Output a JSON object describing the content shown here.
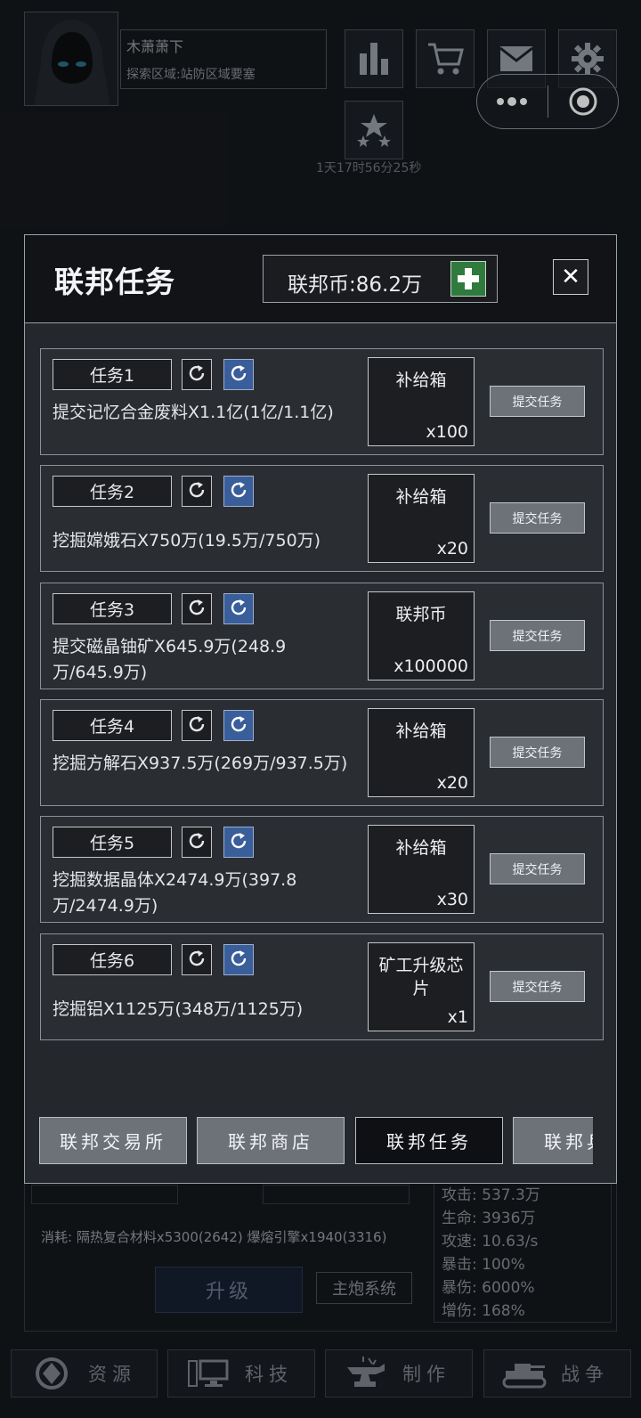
{
  "player": {
    "name": "木萧萧下",
    "region": "探索区域:站防区域要塞",
    "timer": "1天17时56分25秒"
  },
  "top_buttons": [
    "stats-icon",
    "cart-icon",
    "mail-icon",
    "gear-icon",
    "star-icon"
  ],
  "modal": {
    "title": "联邦任务",
    "coin_label": "联邦币:86.2万",
    "close_label": "✕",
    "submit_label": "提交任务",
    "tasks": [
      {
        "name": "任务1",
        "desc": "提交记忆合金废料X1.1亿(1亿/1.1亿)",
        "reward": "补给箱",
        "qty": "x100"
      },
      {
        "name": "任务2",
        "desc": "挖掘嫦娥石X750万(19.5万/750万)",
        "reward": "补给箱",
        "qty": "x20"
      },
      {
        "name": "任务3",
        "desc": "提交磁晶铀矿X645.9万(248.9万/645.9万)",
        "reward": "联邦币",
        "qty": "x100000"
      },
      {
        "name": "任务4",
        "desc": "挖掘方解石X937.5万(269万/937.5万)",
        "reward": "补给箱",
        "qty": "x20"
      },
      {
        "name": "任务5",
        "desc": "挖掘数据晶体X2474.9万(397.8万/2474.9万)",
        "reward": "补给箱",
        "qty": "x30"
      },
      {
        "name": "任务6",
        "desc": "挖掘铝X1125万(348万/1125万)",
        "reward": "矿工升级芯片",
        "qty": "x1"
      }
    ],
    "tabs": [
      {
        "label": "联邦交易所",
        "active": false
      },
      {
        "label": "联邦商店",
        "active": false
      },
      {
        "label": "联邦任务",
        "active": true
      },
      {
        "label": "联邦兵",
        "active": false
      }
    ]
  },
  "background": {
    "cost_text": "消耗: 隔热复合材料x5300(2642) 爆熔引擎x1940(3316)",
    "upgrade_label": "升级",
    "main_system_label": "主炮系统",
    "stats": [
      "攻击: 537.3万",
      "生命: 3936万",
      "攻速: 10.63/s",
      "暴击: 100%",
      "暴伤: 6000%",
      "增伤: 168%"
    ]
  },
  "bottom_nav": [
    {
      "label": "资源",
      "icon": "resource-icon"
    },
    {
      "label": "科技",
      "icon": "computer-icon"
    },
    {
      "label": "制作",
      "icon": "anvil-icon"
    },
    {
      "label": "战争",
      "icon": "tank-icon"
    }
  ],
  "colors": {
    "accent_blue": "#3a5e9a",
    "plus_green": "#2f7a3d",
    "background": "#15181d"
  }
}
